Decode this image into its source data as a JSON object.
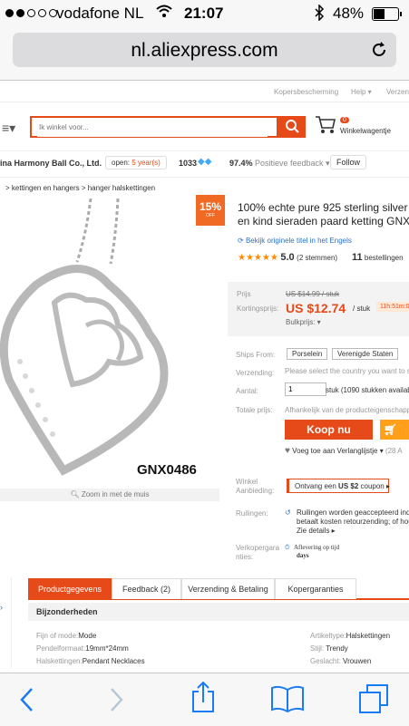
{
  "status": {
    "carrier": "vodafone NL",
    "time": "21:07",
    "battery": "48%"
  },
  "browser": {
    "url": "nl.aliexpress.com"
  },
  "topnav": {
    "buyer_protection": "Kopersbescherming",
    "help": "Help ▾",
    "ship": "Verzen"
  },
  "search": {
    "placeholder": "Ik winkel voor...",
    "cart_count": "0",
    "cart_label": "Winkelwagentje"
  },
  "store": {
    "name": "ina Harmony Ball Co., Ltd.",
    "open_label": "open:",
    "open_years": "5 year(s)",
    "score": "1033",
    "feedback_pct": "97.4%",
    "feedback_label": "Positieve feedback ▾",
    "follow": "Follow"
  },
  "breadcrumb": "> kettingen en hangers > hanger halskettingen",
  "product": {
    "discount": "15%",
    "discount_off": "OFF",
    "image_code": "GNX0486",
    "zoom_hint": "Zoom in met de muis",
    "title_line1": "100% echte pure 925 sterling silver sie",
    "title_line2": "en kind sieraden paard ketting GNX04",
    "original_title_link": "Bekijk originele titel in het Engels",
    "rating": "5.0",
    "rating_count": "(2 stemmen)",
    "orders_count": "11",
    "orders_label": "bestellingen"
  },
  "price": {
    "price_label": "Prijs",
    "old_price": "US $14.99 / stuk",
    "discount_label": "Kortingsprijs:",
    "new_price": "US $12.74",
    "unit": "/ stuk",
    "timer": "11h:51m:05",
    "bulk": "Bulkprijs: ▾"
  },
  "shipping": {
    "ships_from_label": "Ships From:",
    "opt1": "Porselein",
    "opt2": "Verenigde Staten",
    "delivery_label": "Verzending:",
    "delivery_value": "Please select the country you want to sh",
    "qty_label": "Aantal:",
    "qty_value": "1",
    "qty_suffix": "stuk (1090 stukken available",
    "total_label": "Totale prijs:",
    "total_value": "Afhankelijk van de producteigenschappe",
    "buy_now": "Koop nu",
    "add_cart": "Vo",
    "wishlist": "Voeg toe aan Verlanglijstje ▾",
    "wishlist_count": "(28 A"
  },
  "store_discount": {
    "label_line1": "Winkel",
    "label_line2": "Aanbieding:",
    "coupon_prefix": "Ontvang een ",
    "coupon_amount": "US $2",
    "coupon_suffix": " coupon ▸"
  },
  "returns": {
    "label": "Ruilingen:",
    "line1": "Ruilingen worden geaccepteerd indie",
    "line2": "betaalt kosten retourzending; of houd",
    "details": "Zie details ▸"
  },
  "guarantee": {
    "label_line1": "Verkopergara",
    "label_line2": "nties:",
    "line1": "Aflevering op tijd",
    "line2": "days"
  },
  "tabs": [
    "Productgegevens",
    "Feedback (2)",
    "Verzending & Betaling",
    "Kopergaranties"
  ],
  "specs_title": "Bijzonderheden",
  "specs": [
    {
      "k1": "Fijn of mode:",
      "v1": "Mode",
      "k2": "Artikeltype:",
      "v2": "Halskettingen"
    },
    {
      "k1": "Pendelformaat:",
      "v1": "19mm*24mm",
      "k2": "Stijl:",
      "v2": "Trendy"
    },
    {
      "k1": "Halskettingen:",
      "v1": "Pendant Necklaces",
      "k2": "Geslacht:",
      "v2": "Vrouwen"
    }
  ],
  "colors": {
    "accent": "#e64a19",
    "link": "#2b72c2"
  }
}
